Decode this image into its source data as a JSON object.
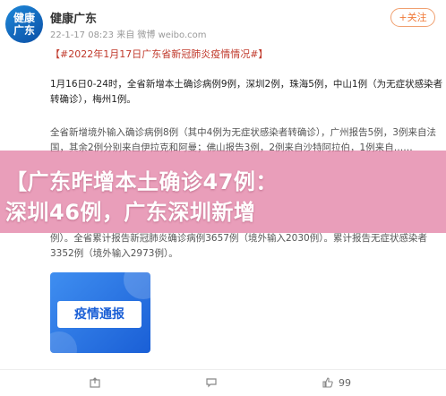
{
  "post": {
    "author": "健康广东",
    "avatar_text": "健康\n广东",
    "timestamp": "22-1-17 08:23",
    "source": "来自 微博 weibo.com",
    "follow_label": "+关注",
    "hashtag": "【#2022年1月17日广东省新冠肺炎疫情情况#】",
    "paragraph_1": "1月16日0-24时，全省新增本土确诊病例9例，深圳2例，珠海5例，中山1例（为无症状感染者转确诊），梅州1例。",
    "paragraph_2": "全省新增境外输入确诊病例8例（其中4例为无症状感染者转确诊），广州报告5例，3例来自法国，其余2例分别来自伊拉克和阿曼；佛山报告3例，2例来自沙特阿拉伯，1例来自……",
    "paragraph_3": "例）。全省累计报告新冠肺炎确诊病例3657例（境外输入2030例）。累计报告无症状感染者3352例（境外输入2973例）。"
  },
  "overlay_banner": "【广东昨增本土确诊47例：\n深圳46例，广东深圳新增",
  "thumbnail_label": "疫情通报",
  "actions": {
    "share": "",
    "comment": "",
    "like": "99"
  }
}
